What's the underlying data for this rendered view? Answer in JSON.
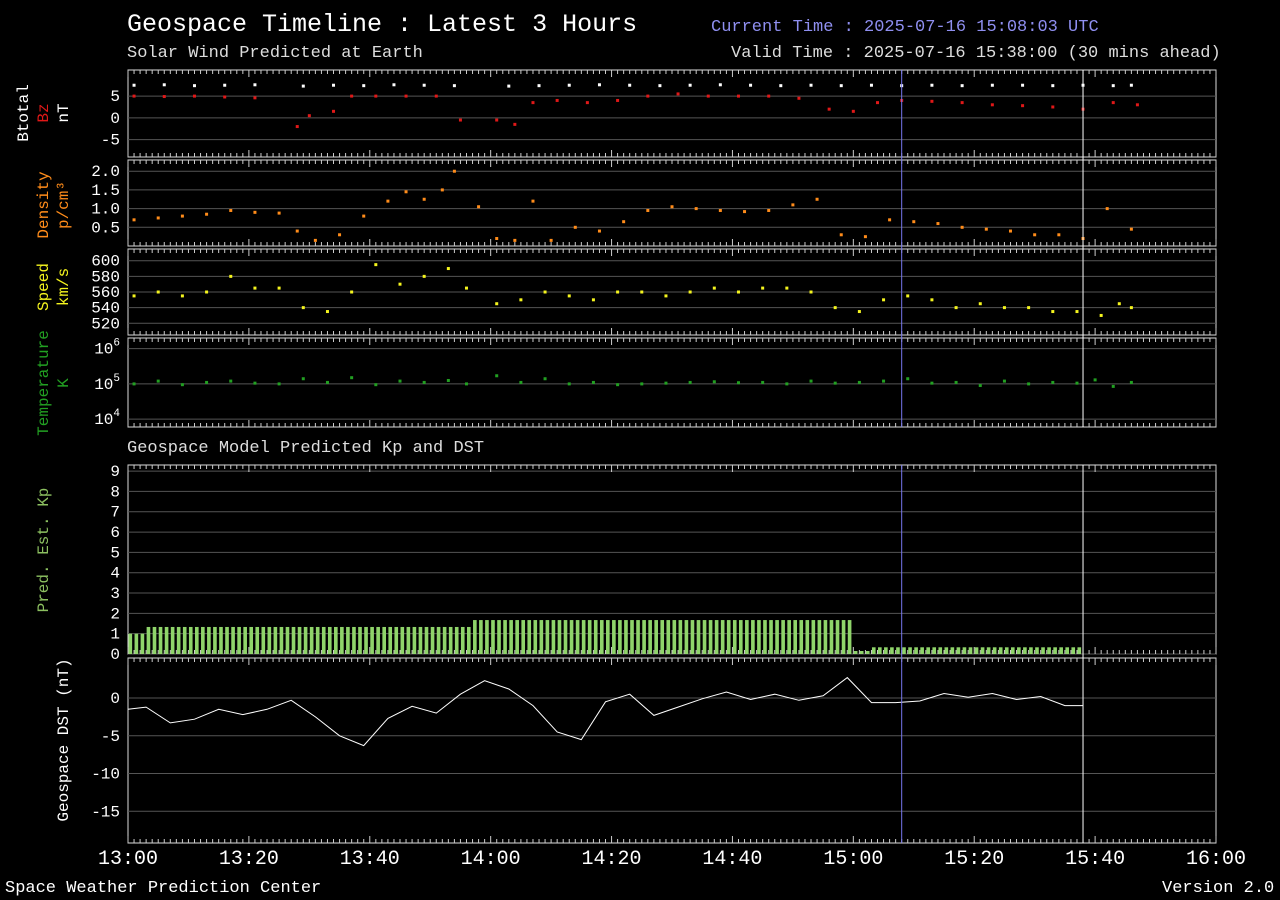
{
  "header": {
    "title": "Geospace Timeline : Latest 3 Hours",
    "subtitle": "Solar Wind Predicted at Earth",
    "current_time": "Current Time : 2025-07-16 15:08:03 UTC",
    "valid_time": "Valid Time : 2025-07-16 15:38:00 (30 mins ahead)"
  },
  "section2_title": "Geospace Model Predicted Kp and DST",
  "footer": {
    "left": "Space Weather Prediction Center",
    "right": "Version 2.0"
  },
  "colors": {
    "background": "#000000",
    "btotal": "#ffffff",
    "bz": "#e01818",
    "density": "#ff8c1a",
    "speed": "#f5f51e",
    "temperature": "#22a022",
    "kp_bar": "#8fd46a",
    "kp_label": "#8cc060",
    "dst_line": "#ffffff",
    "current_time_line": "#7777ee",
    "valid_time_line": "#ffffff",
    "grid": "#555555"
  },
  "chart_data": [
    {
      "type": "scatter",
      "panel": "magnetic",
      "ylabels": [
        "Btotal",
        "Bz",
        "nT"
      ],
      "yticks": [
        "5",
        "0",
        "-5"
      ],
      "ylim": [
        -9,
        11
      ],
      "grid": true,
      "series": [
        {
          "name": "Btotal",
          "x": [
            "13:01",
            "13:06",
            "13:11",
            "13:16",
            "13:21",
            "13:29",
            "13:34",
            "13:39",
            "13:44",
            "13:49",
            "13:54",
            "14:03",
            "14:08",
            "14:13",
            "14:18",
            "14:23",
            "14:28",
            "14:33",
            "14:38",
            "14:43",
            "14:48",
            "14:53",
            "14:58",
            "15:03",
            "15:08",
            "15:13",
            "15:18",
            "15:23",
            "15:28",
            "15:33",
            "15:38",
            "15:43",
            "15:46"
          ],
          "y": [
            7.5,
            7.6,
            7.4,
            7.5,
            7.6,
            7.3,
            7.5,
            7.4,
            7.6,
            7.5,
            7.4,
            7.3,
            7.4,
            7.5,
            7.6,
            7.5,
            7.4,
            7.5,
            7.6,
            7.5,
            7.4,
            7.5,
            7.4,
            7.5,
            7.4,
            7.5,
            7.4,
            7.5,
            7.5,
            7.4,
            7.5,
            7.4,
            7.5
          ]
        },
        {
          "name": "Bz",
          "x": [
            "13:01",
            "13:06",
            "13:11",
            "13:16",
            "13:21",
            "13:28",
            "13:30",
            "13:34",
            "13:37",
            "13:41",
            "13:46",
            "13:51",
            "13:55",
            "14:01",
            "14:04",
            "14:07",
            "14:11",
            "14:16",
            "14:21",
            "14:26",
            "14:31",
            "14:36",
            "14:41",
            "14:46",
            "14:51",
            "14:56",
            "15:00",
            "15:04",
            "15:08",
            "15:13",
            "15:18",
            "15:23",
            "15:28",
            "15:33",
            "15:38",
            "15:43",
            "15:47"
          ],
          "y": [
            5,
            4.9,
            5,
            4.8,
            4.6,
            -2,
            0.5,
            1.5,
            5,
            5,
            5,
            5,
            -0.5,
            -0.5,
            -1.5,
            3.5,
            4,
            3.5,
            4,
            5,
            5.5,
            5,
            5,
            5,
            4.5,
            2,
            1.5,
            3.5,
            4,
            3.8,
            3.5,
            3,
            2.8,
            2.5,
            2,
            3.5,
            3
          ]
        }
      ]
    },
    {
      "type": "scatter",
      "panel": "density",
      "ylabels": [
        "Density",
        "p/cm³"
      ],
      "yticks": [
        "2.0",
        "1.5",
        "1.0",
        "0.5"
      ],
      "ylim": [
        0,
        2.3
      ],
      "grid": true,
      "series": [
        {
          "name": "Density",
          "x": [
            "13:01",
            "13:05",
            "13:09",
            "13:13",
            "13:17",
            "13:21",
            "13:25",
            "13:28",
            "13:31",
            "13:35",
            "13:39",
            "13:43",
            "13:46",
            "13:49",
            "13:52",
            "13:54",
            "13:58",
            "14:01",
            "14:04",
            "14:07",
            "14:10",
            "14:14",
            "14:18",
            "14:22",
            "14:26",
            "14:30",
            "14:34",
            "14:38",
            "14:42",
            "14:46",
            "14:50",
            "14:54",
            "14:58",
            "15:02",
            "15:06",
            "15:10",
            "15:14",
            "15:18",
            "15:22",
            "15:26",
            "15:30",
            "15:34",
            "15:38",
            "15:42",
            "15:46"
          ],
          "y": [
            0.7,
            0.75,
            0.8,
            0.85,
            0.95,
            0.9,
            0.88,
            0.4,
            0.15,
            0.3,
            0.8,
            1.2,
            1.45,
            1.25,
            1.5,
            2.0,
            1.05,
            0.2,
            0.15,
            1.2,
            0.15,
            0.5,
            0.4,
            0.65,
            0.95,
            1.05,
            1.0,
            0.95,
            0.92,
            0.95,
            1.1,
            1.25,
            0.3,
            0.25,
            0.7,
            0.65,
            0.6,
            0.5,
            0.45,
            0.4,
            0.3,
            0.3,
            0.2,
            1.0,
            0.45
          ]
        }
      ]
    },
    {
      "type": "scatter",
      "panel": "speed",
      "ylabels": [
        "Speed",
        "km/s"
      ],
      "yticks": [
        "600",
        "580",
        "560",
        "540",
        "520"
      ],
      "ylim": [
        505,
        615
      ],
      "grid": true,
      "series": [
        {
          "name": "Speed",
          "x": [
            "13:01",
            "13:05",
            "13:09",
            "13:13",
            "13:17",
            "13:21",
            "13:25",
            "13:29",
            "13:33",
            "13:37",
            "13:41",
            "13:45",
            "13:49",
            "13:53",
            "13:56",
            "14:01",
            "14:05",
            "14:09",
            "14:13",
            "14:17",
            "14:21",
            "14:25",
            "14:29",
            "14:33",
            "14:37",
            "14:41",
            "14:45",
            "14:49",
            "14:53",
            "14:57",
            "15:01",
            "15:05",
            "15:09",
            "15:13",
            "15:17",
            "15:21",
            "15:25",
            "15:29",
            "15:33",
            "15:37",
            "15:41",
            "15:44",
            "15:46"
          ],
          "y": [
            555,
            560,
            555,
            560,
            580,
            565,
            565,
            540,
            535,
            560,
            595,
            570,
            580,
            590,
            565,
            545,
            550,
            560,
            555,
            550,
            560,
            560,
            555,
            560,
            565,
            560,
            565,
            565,
            560,
            540,
            535,
            550,
            555,
            550,
            540,
            545,
            540,
            540,
            535,
            535,
            530,
            545,
            540
          ]
        }
      ]
    },
    {
      "type": "scatter",
      "panel": "temperature",
      "ylabels": [
        "Temperature",
        "K"
      ],
      "yticks": [
        "10^6",
        "10^5",
        "10^4"
      ],
      "yscale": "log",
      "ylim": [
        6000,
        2000000
      ],
      "grid": true,
      "series": [
        {
          "name": "Temperature",
          "x": [
            "13:01",
            "13:05",
            "13:09",
            "13:13",
            "13:17",
            "13:21",
            "13:25",
            "13:29",
            "13:33",
            "13:37",
            "13:41",
            "13:45",
            "13:49",
            "13:53",
            "13:56",
            "14:01",
            "14:05",
            "14:09",
            "14:13",
            "14:17",
            "14:21",
            "14:25",
            "14:29",
            "14:33",
            "14:37",
            "14:41",
            "14:45",
            "14:49",
            "14:53",
            "14:57",
            "15:01",
            "15:05",
            "15:09",
            "15:13",
            "15:17",
            "15:21",
            "15:25",
            "15:29",
            "15:33",
            "15:37",
            "15:40",
            "15:43",
            "15:46"
          ],
          "y": [
            100000,
            120000,
            95000,
            110000,
            120000,
            105000,
            100000,
            140000,
            110000,
            150000,
            95000,
            120000,
            110000,
            125000,
            100000,
            170000,
            110000,
            140000,
            100000,
            110000,
            95000,
            100000,
            105000,
            110000,
            115000,
            108000,
            110000,
            100000,
            120000,
            105000,
            110000,
            120000,
            140000,
            105000,
            110000,
            90000,
            120000,
            100000,
            110000,
            105000,
            130000,
            85000,
            110000
          ]
        }
      ]
    },
    {
      "type": "bar",
      "panel": "kp",
      "ylabel": "Pred. Est. Kp",
      "yticks": [
        "9",
        "8",
        "7",
        "6",
        "5",
        "4",
        "3",
        "2",
        "1",
        "0"
      ],
      "ylim": [
        0,
        9.3
      ],
      "grid": true,
      "segments": [
        {
          "from": "13:00",
          "to": "13:03",
          "value": 1.0
        },
        {
          "from": "13:03",
          "to": "13:57",
          "value": 1.33
        },
        {
          "from": "13:57",
          "to": "15:00",
          "value": 1.67
        },
        {
          "from": "15:00",
          "to": "15:03",
          "value": 0.0
        },
        {
          "from": "15:03",
          "to": "15:38",
          "value": 0.33
        }
      ]
    },
    {
      "type": "line",
      "panel": "dst",
      "ylabel": "Geospace DST (nT)",
      "yticks": [
        "0",
        "-5",
        "-10",
        "-15",
        ""
      ],
      "ylim": [
        -19.2,
        5.3
      ],
      "grid": true,
      "x": [
        "13:00",
        "13:03",
        "13:07",
        "13:11",
        "13:15",
        "13:19",
        "13:23",
        "13:27",
        "13:31",
        "13:35",
        "13:39",
        "13:43",
        "13:47",
        "13:51",
        "13:55",
        "13:59",
        "14:03",
        "14:07",
        "14:11",
        "14:15",
        "14:19",
        "14:23",
        "14:27",
        "14:31",
        "14:35",
        "14:39",
        "14:43",
        "14:47",
        "14:51",
        "14:55",
        "14:59",
        "15:03",
        "15:07",
        "15:11",
        "15:15",
        "15:19",
        "15:23",
        "15:27",
        "15:31",
        "15:35",
        "15:38"
      ],
      "y": [
        -1.5,
        -1.2,
        -3.3,
        -2.8,
        -1.5,
        -2.2,
        -1.5,
        -0.3,
        -2.5,
        -5.0,
        -6.3,
        -2.7,
        -1.1,
        -2.0,
        0.5,
        2.3,
        1.2,
        -1.0,
        -4.5,
        -5.5,
        -0.5,
        0.5,
        -2.3,
        -1.2,
        -0.1,
        0.8,
        -0.2,
        0.5,
        -0.3,
        0.3,
        2.7,
        -0.6,
        -0.6,
        -0.4,
        0.6,
        0.1,
        0.6,
        -0.2,
        0.2,
        -1.0,
        -1.0
      ]
    }
  ],
  "x_axis": {
    "ticks": [
      "13:00",
      "13:20",
      "13:40",
      "14:00",
      "14:20",
      "14:40",
      "15:00",
      "15:20",
      "15:40",
      "16:00"
    ],
    "start": "13:00",
    "end": "16:00",
    "current_time": "15:08",
    "valid_time": "15:38"
  }
}
